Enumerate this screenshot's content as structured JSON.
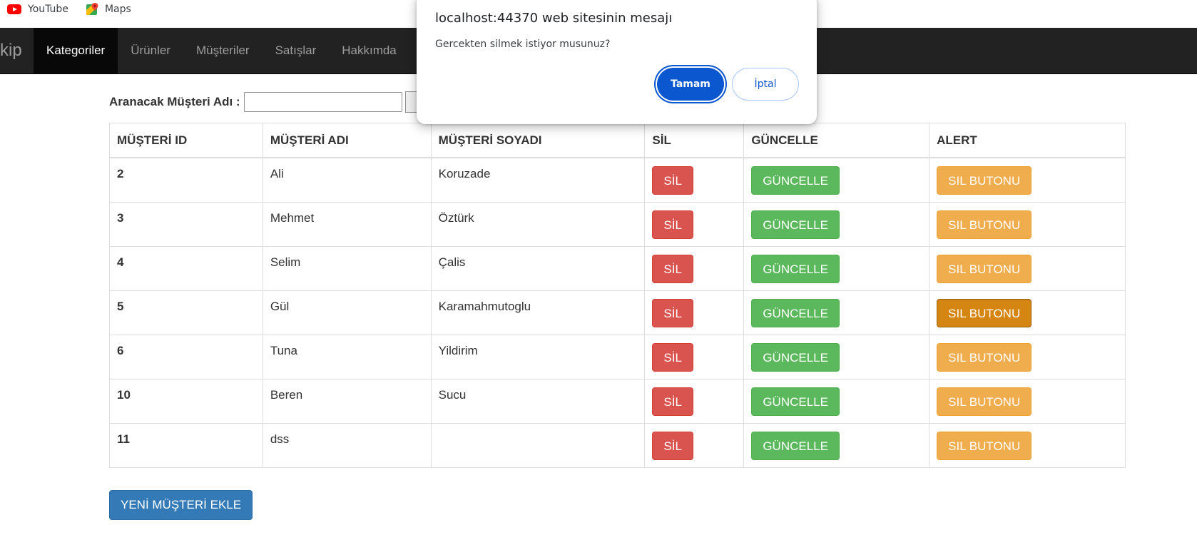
{
  "bookmarks": [
    {
      "label": "YouTube",
      "icon": "youtube-icon"
    },
    {
      "label": "Maps",
      "icon": "maps-icon"
    }
  ],
  "navbar": {
    "brand": "kip",
    "items": [
      "Kategoriler",
      "Ürünler",
      "Müşteriler",
      "Satışlar",
      "Hakkımda"
    ],
    "active": "Kategoriler"
  },
  "search": {
    "label": "Aranacak Müşteri Adı :",
    "value": ""
  },
  "table": {
    "headers": [
      "MÜŞTERİ ID",
      "MÜŞTERİ ADI",
      "MÜŞTERİ SOYADI",
      "SİL",
      "GÜNCELLE",
      "ALERT"
    ],
    "rows": [
      {
        "id": "2",
        "ad": "Ali",
        "soyad": "Koruzade"
      },
      {
        "id": "3",
        "ad": "Mehmet",
        "soyad": "Öztürk"
      },
      {
        "id": "4",
        "ad": "Selim",
        "soyad": "Çalis"
      },
      {
        "id": "5",
        "ad": "Gül",
        "soyad": "Karamahmutoglu"
      },
      {
        "id": "6",
        "ad": "Tuna",
        "soyad": "Yildirim"
      },
      {
        "id": "10",
        "ad": "Beren",
        "soyad": "Sucu"
      },
      {
        "id": "11",
        "ad": "dss",
        "soyad": ""
      }
    ],
    "delete_label": "SİL",
    "update_label": "GÜNCELLE",
    "alert_label": "SIL BUTONU",
    "hovered_alert_row": "5"
  },
  "add_button": "YENİ MÜŞTERİ EKLE",
  "dialog": {
    "title": "localhost:44370 web sitesinin mesajı",
    "message": "Gercekten silmek istiyor musunuz?",
    "ok_label": "Tamam",
    "cancel_label": "İptal"
  },
  "colors": {
    "navbar_bg": "#222222",
    "danger": "#d9534f",
    "success": "#5cb85c",
    "warning": "#f0ad4e",
    "primary": "#337ab7",
    "dialog_button": "#0b57d0"
  }
}
